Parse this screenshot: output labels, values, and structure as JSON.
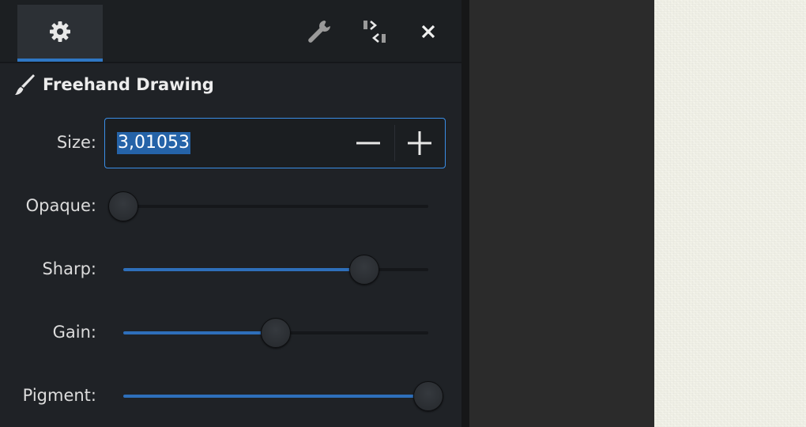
{
  "header": {
    "tabs": [
      {
        "icon": "gear-icon",
        "active": true
      }
    ],
    "buttons": {
      "wrench_icon": "wrench-icon",
      "panel_toggle_icon": "panel-toggle-icon",
      "close_icon": "close-icon"
    }
  },
  "tool": {
    "title": "Freehand Drawing",
    "icon": "brush-icon"
  },
  "size": {
    "label": "Size:",
    "value": "3,01053",
    "decrement_symbol": "−",
    "increment_symbol": "+"
  },
  "sliders": [
    {
      "key": "opaque",
      "label": "Opaque:",
      "value": 0.0
    },
    {
      "key": "sharp",
      "label": "Sharp:",
      "value": 0.79
    },
    {
      "key": "gain",
      "label": "Gain:",
      "value": 0.5
    },
    {
      "key": "pigment",
      "label": "Pigment:",
      "value": 1.0
    }
  ],
  "colors": {
    "accent": "#2f77c4",
    "panel_bg": "#1f2226",
    "paper": "#f0f0e6"
  }
}
